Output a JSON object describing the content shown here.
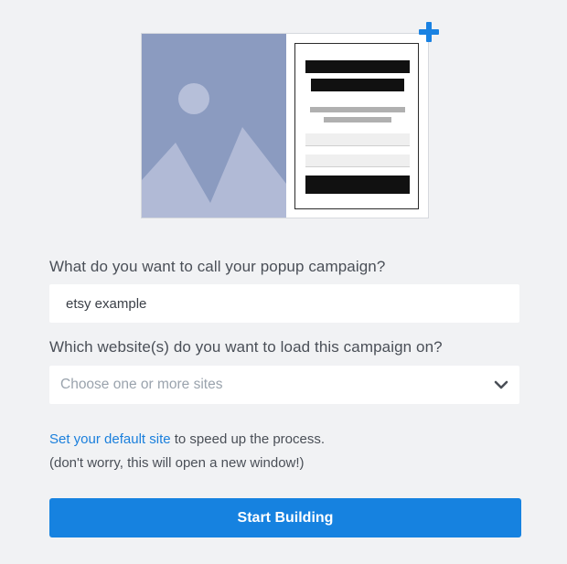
{
  "form": {
    "name_label": "What do you want to call your popup campaign?",
    "name_value": "etsy example",
    "sites_label": "Which website(s) do you want to load this campaign on?",
    "sites_placeholder": "Choose one or more sites"
  },
  "helper": {
    "link_text": "Set your default site",
    "after_link": " to speed up the process.",
    "note": "(don't worry, this will open a new window!)"
  },
  "actions": {
    "start_label": "Start Building"
  },
  "colors": {
    "accent": "#1682e0",
    "link": "#1a7fdc",
    "illustration_bg": "#8b9bc0",
    "illustration_mountain": "#b1bad6",
    "page_bg": "#f1f2f4"
  },
  "icons": {
    "add": "plus-icon",
    "dropdown": "chevron-down-icon",
    "illustration": "image-placeholder-icon"
  }
}
